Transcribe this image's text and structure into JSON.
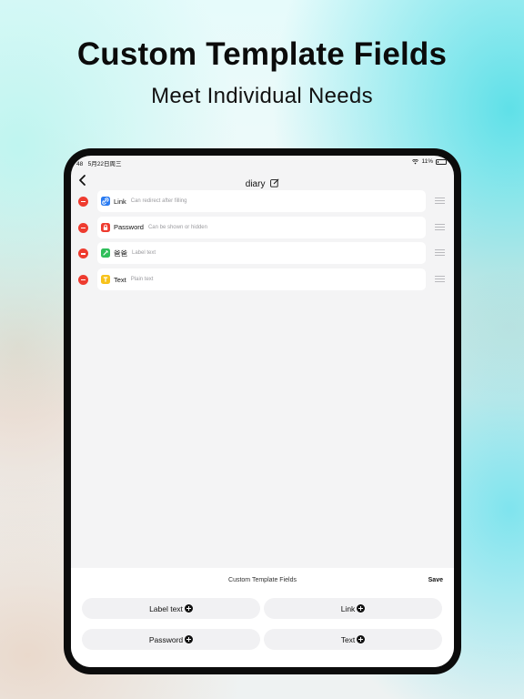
{
  "headline": "Custom Template Fields",
  "subheadline": "Meet Individual Needs",
  "status_bar": {
    "time": "48",
    "date": "5月22日周三",
    "battery": "11%"
  },
  "nav": {
    "title": "diary",
    "back_icon": "chevron-left-icon",
    "edit_icon": "edit-icon"
  },
  "fields": [
    {
      "name": "Link",
      "description": "Can redirect after filling",
      "icon": "link-icon",
      "icon_color": "#2a7bf2",
      "glyph": "🔗"
    },
    {
      "name": "Password",
      "description": "Can be shown or hidden",
      "icon": "lock-icon",
      "icon_color": "#ee3b2f",
      "glyph": "🔒"
    },
    {
      "name": "爸爸",
      "description": "Label text",
      "icon": "tag-icon",
      "icon_color": "#2fbe5a",
      "glyph": "✎"
    },
    {
      "name": "Text",
      "description": "Plain text",
      "icon": "text-icon",
      "icon_color": "#f7c21a",
      "glyph": "T"
    }
  ],
  "panel": {
    "title": "Custom Template Fields",
    "save_label": "Save",
    "buttons": [
      {
        "label": "Label text"
      },
      {
        "label": "Link"
      },
      {
        "label": "Password"
      },
      {
        "label": "Text"
      }
    ]
  },
  "colors": {
    "remove": "#ee3b2f",
    "device_frame": "#0c0c0c",
    "screen_bg": "#f4f4f5"
  }
}
